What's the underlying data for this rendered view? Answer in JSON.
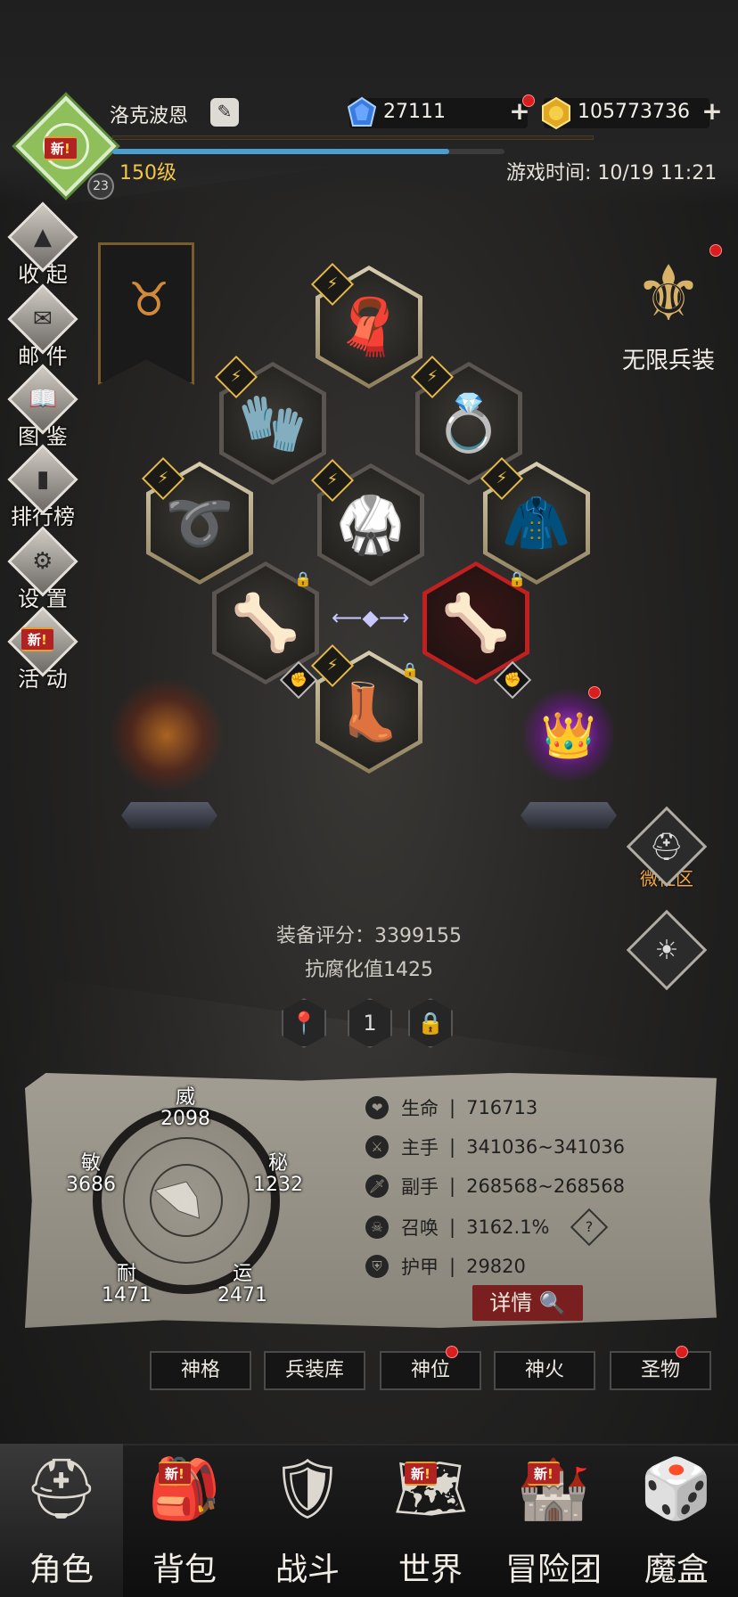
{
  "header": {
    "player_name": "洛克波恩",
    "level_badge": "23",
    "level_text": "150级",
    "xp_fraction": 0.86,
    "game_time_label": "游戏时间: 10/19 11:21",
    "avatar_new": "新",
    "gems": {
      "value": "27111",
      "icon": "blue-gem-icon"
    },
    "gold": {
      "value": "105773736",
      "icon": "gold-coin-icon"
    }
  },
  "side_menu": [
    {
      "label": "收 起",
      "icon": "collapse-icon"
    },
    {
      "label": "邮 件",
      "icon": "mail-icon"
    },
    {
      "label": "图 鉴",
      "icon": "codex-book-icon"
    },
    {
      "label": "排行榜",
      "icon": "ranking-icon"
    },
    {
      "label": "设 置",
      "icon": "gear-icon"
    },
    {
      "label": "活 动",
      "icon": "event-icon",
      "new": "新"
    }
  ],
  "wuxian": {
    "label": "无限兵装"
  },
  "right_icons": [
    {
      "label": "微社区",
      "icon": "helmet-icon"
    },
    {
      "label": "",
      "icon": "crest-badge-icon"
    }
  ],
  "score": {
    "equip_score": "装备评分：3399155",
    "anti_corruption": "抗腐化值1425"
  },
  "slot_number": "1",
  "radar": {
    "top": {
      "name": "威",
      "value": "2098"
    },
    "right": {
      "name": "秘",
      "value": "1232"
    },
    "bottom_right": {
      "name": "运",
      "value": "2471"
    },
    "bottom_left": {
      "name": "耐",
      "value": "1471"
    },
    "left": {
      "name": "敏",
      "value": "3686"
    }
  },
  "stats": [
    {
      "name": "生命",
      "value": "716713",
      "icon": "heart-icon"
    },
    {
      "name": "主手",
      "value": "341036~341036",
      "icon": "sword-icon"
    },
    {
      "name": "副手",
      "value": "268568~268568",
      "icon": "dagger-icon"
    },
    {
      "name": "召唤",
      "value": "3162.1%",
      "icon": "summon-icon"
    },
    {
      "name": "护甲",
      "value": "29820",
      "icon": "armor-icon"
    }
  ],
  "detail_button": "详情",
  "tabs": [
    {
      "label": "神格"
    },
    {
      "label": "兵装库"
    },
    {
      "label": "神位"
    },
    {
      "label": "神火"
    },
    {
      "label": "圣物"
    }
  ],
  "nav": [
    {
      "label": "角色",
      "icon": "hero-helmet-icon"
    },
    {
      "label": "背包",
      "icon": "backpack-icon",
      "new": "新"
    },
    {
      "label": "战斗",
      "icon": "battle-shield-icon"
    },
    {
      "label": "世界",
      "icon": "world-map-icon",
      "new": "新"
    },
    {
      "label": "冒险团",
      "icon": "adventure-team-icon",
      "new": "新"
    },
    {
      "label": "魔盒",
      "icon": "magic-box-icon"
    }
  ],
  "colors": {
    "level": "#f1c646",
    "notify": "#d81e1e",
    "xp": "#4a9fd0",
    "detail": "#7a1f1f"
  }
}
